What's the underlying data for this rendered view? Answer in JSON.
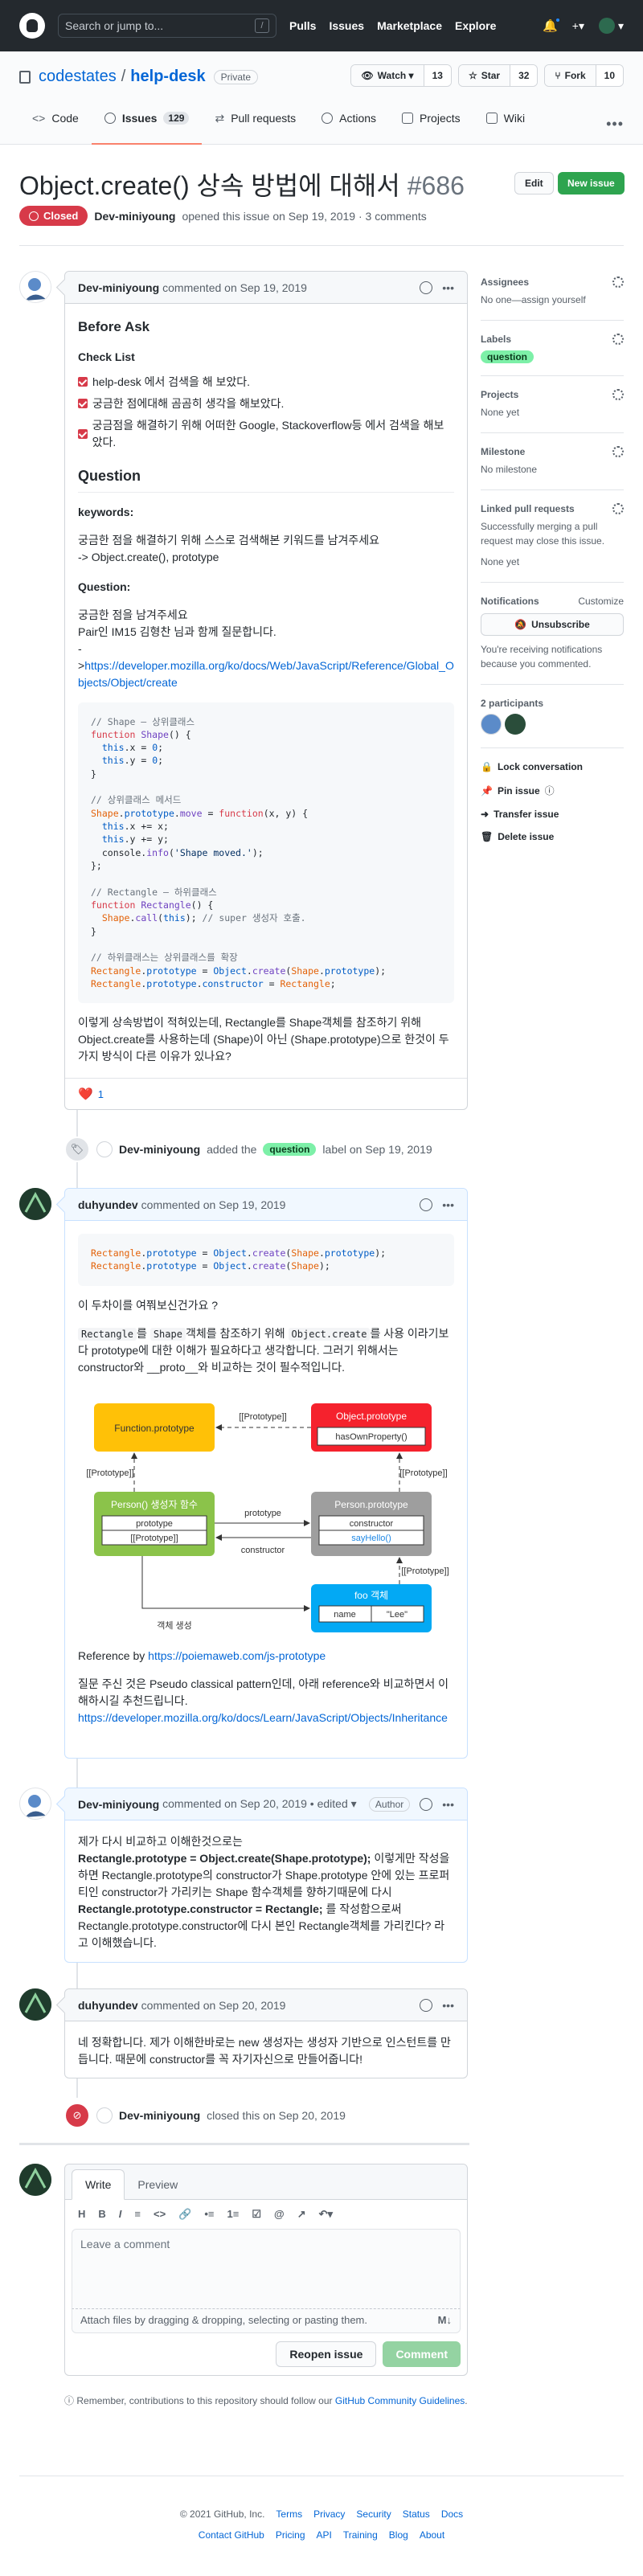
{
  "header": {
    "search_placeholder": "Search or jump to...",
    "slash_key": "/",
    "nav": [
      "Pulls",
      "Issues",
      "Marketplace",
      "Explore"
    ],
    "plus": "+▾"
  },
  "repo": {
    "owner": "codestates",
    "separator": "/",
    "name": "help-desk",
    "visibility": "Private",
    "watch_label": "Watch ▾",
    "watch_count": "13",
    "star_label": "Star",
    "star_count": "32",
    "fork_label": "Fork",
    "fork_count": "10",
    "tabs": [
      {
        "label": "Code",
        "count": ""
      },
      {
        "label": "Issues",
        "count": "129"
      },
      {
        "label": "Pull requests",
        "count": ""
      },
      {
        "label": "Actions",
        "count": ""
      },
      {
        "label": "Projects",
        "count": ""
      },
      {
        "label": "Wiki",
        "count": ""
      }
    ],
    "more": "•••"
  },
  "issue": {
    "title": "Object.create() 상속 방법에 대해서",
    "number": "#686",
    "edit_label": "Edit",
    "new_issue_label": "New issue",
    "state": "Closed",
    "author": "Dev-miniyoung",
    "meta": "opened this issue on Sep 19, 2019 · 3 comments"
  },
  "comment1": {
    "author": "Dev-miniyoung",
    "meta": "commented on Sep 19, 2019",
    "before_ask": "Before Ask",
    "checklist_title": "Check List",
    "checklist": [
      "help-desk 에서 검색을 해 보았다.",
      "궁금한 점에대해 곰곰히 생각을 해보았다.",
      "궁금점을 해결하기 위해 어떠한 Google, Stackoverflow등 에서 검색을 해보았다."
    ],
    "question_heading": "Question",
    "keywords_label": "keywords:",
    "keywords_text1": "궁금한 점을 해결하기 위해 스스로 검색해본 키워드를 남겨주세요",
    "keywords_text2": "-> Object.create(), prototype",
    "question_label": "Question:",
    "q_line1": "궁금한 점을 남겨주세요",
    "q_line2": "Pair인 IM15 김형찬 님과 함께 질문합니다.",
    "q_line3": "-",
    "q_link": "https://developer.mozilla.org/ko/docs/Web/JavaScript/Reference/Global_Objects/Object/create",
    "q_link_prefix": ">",
    "closing": "이렇게 상속방법이 적혀있는데, Rectangle를 Shape객체를 참조하기 위해 Object.create를 사용하는데 (Shape)이 아닌 (Shape.prototype)으로 한것이 두 가지 방식이 다른 이유가 있나요?",
    "reaction_count": "1"
  },
  "event_label": {
    "actor": "Dev-miniyoung",
    "text_a": "added the",
    "label": "question",
    "text_b": "label on Sep 19, 2019"
  },
  "comment2": {
    "author": "duhyundev",
    "meta": "commented on Sep 19, 2019",
    "ask": "이 두차이를 여쭤보신건가요 ?",
    "p1_code1": "Rectangle",
    "p1_t1": "를",
    "p1_code2": "Shape",
    "p1_t2": "객체를 참조하기 위해",
    "p1_code3": "Object.create",
    "p1_t3": "를 사용 이라기보다 prototype에 대한 이해가 필요하다고 생각합니다. 그러기 위해서는 constructor와 __proto__와 비교하는 것이 필수적입니다.",
    "ref_label": "Reference by",
    "ref_link": "https://poiemaweb.com/js-prototype",
    "extra": "질문 주신 것은 Pseudo classical pattern인데, 아래 reference와 비교하면서 이해하시길 추천드립니다.",
    "extra_link": "https://developer.mozilla.org/ko/docs/Learn/JavaScript/Objects/Inheritance"
  },
  "diagram": {
    "function_prototype": "Function.prototype",
    "object_prototype": "Object.prototype",
    "has_own_property": "hasOwnProperty()",
    "proto1": "[[Prototype]]",
    "proto2": "[[Prototype]]",
    "proto3": "[[Prototype]]",
    "proto4": "[[Prototype]]",
    "person_ctor": "Person() 생성자 함수",
    "prototype_row": "prototype",
    "proto_row": "[[Prototype]]",
    "person_proto": "Person.prototype",
    "constructor_row": "constructor",
    "sayhello_row": "sayHello()",
    "edge_prototype": "prototype",
    "edge_constructor": "constructor",
    "foo_obj": "foo 객체",
    "foo_name": "name",
    "foo_value": "\"Lee\"",
    "create_label": "객체 생성"
  },
  "comment3": {
    "author": "Dev-miniyoung",
    "meta": "commented on Sep 20, 2019 • edited ▾",
    "badge": "Author",
    "text_pre": "제가 다시 비교하고 이해한것으로는",
    "bold1": "Rectangle.prototype = Object.create(Shape.prototype);",
    "text_mid": "이렇게만 작성을 하면 Rectangle.prototype의 constructor가 Shape.prototype 안에 있는 프로퍼티인 constructor가 가리키는 Shape 함수객체를 향하기때문에 다시",
    "bold2": "Rectangle.prototype.constructor = Rectangle;",
    "text_post": "를 작성함으로써 Rectangle.prototype.constructor에 다시 본인 Rectangle객체를 가리킨다? 라고 이해했습니다."
  },
  "comment4": {
    "author": "duhyundev",
    "meta": "commented on Sep 20, 2019",
    "text": "네 정확합니다. 제가 이해한바로는 new 생성자는 생성자 기반으로 인스턴트를 만듭니다. 때문에 constructor를 꼭 자기자신으로 만들어줍니다!"
  },
  "event_closed": {
    "actor": "Dev-miniyoung",
    "text": "closed this on Sep 20, 2019"
  },
  "form": {
    "tab_write": "Write",
    "tab_preview": "Preview",
    "toolbar": [
      "H",
      "B",
      "I",
      "≡",
      "<>",
      "🔗",
      "•≡",
      "1≡",
      "☑",
      "@",
      "↗",
      "↶▾"
    ],
    "placeholder": "Leave a comment",
    "attach_text": "Attach files by dragging & dropping, selecting or pasting them.",
    "md_icon": "M↓",
    "reopen_label": "Reopen issue",
    "comment_label": "Comment",
    "remember_text": "Remember, contributions to this repository should follow our",
    "remember_link": "GitHub Community Guidelines",
    "remember_end": "."
  },
  "sidebar": {
    "assignees_title": "Assignees",
    "assignees_value": "No one—assign yourself",
    "labels_title": "Labels",
    "label_value": "question",
    "projects_title": "Projects",
    "projects_value": "None yet",
    "milestone_title": "Milestone",
    "milestone_value": "No milestone",
    "linked_title": "Linked pull requests",
    "linked_desc": "Successfully merging a pull request may close this issue.",
    "linked_value": "None yet",
    "notif_title": "Notifications",
    "notif_customize": "Customize",
    "unsubscribe": "Unsubscribe",
    "notif_desc": "You're receiving notifications because you commented.",
    "participants_title": "2 participants",
    "lock": "Lock conversation",
    "pin": "Pin issue",
    "transfer": "Transfer issue",
    "delete": "Delete issue"
  },
  "footer": {
    "copyright": "© 2021 GitHub, Inc.",
    "row1": [
      "Terms",
      "Privacy",
      "Security",
      "Status",
      "Docs"
    ],
    "row2": [
      "Contact GitHub",
      "Pricing",
      "API",
      "Training",
      "Blog",
      "About"
    ]
  }
}
